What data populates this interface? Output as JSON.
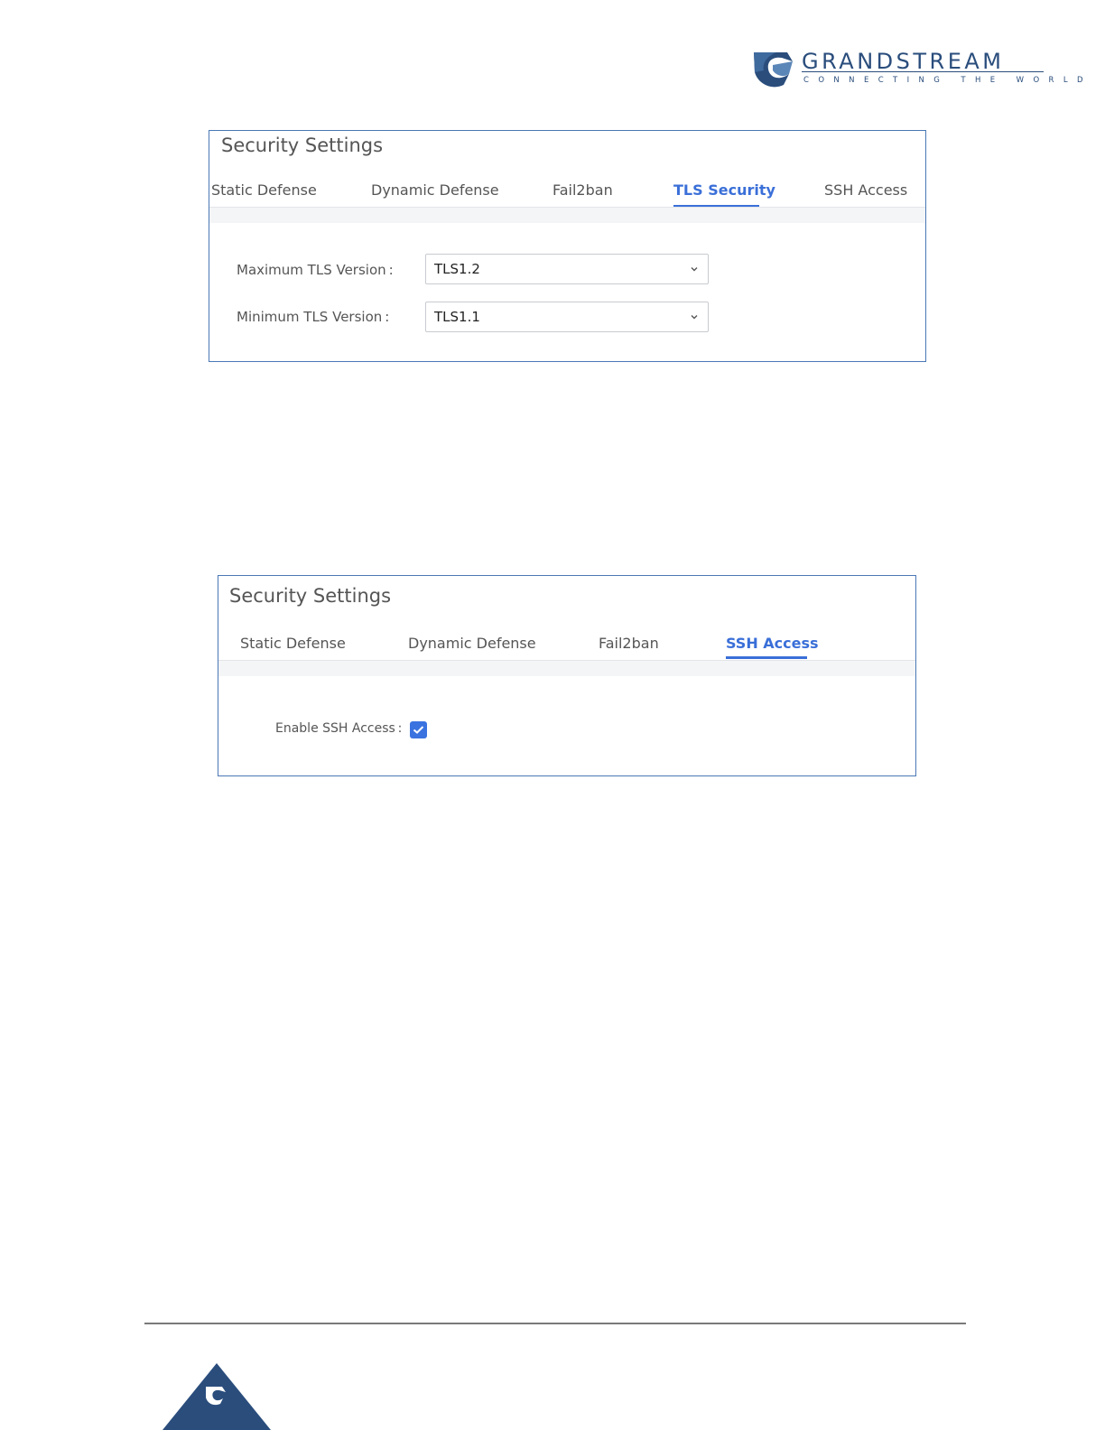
{
  "brand": {
    "name": "GRANDSTREAM",
    "tagline": "CONNECTING THE WORLD",
    "color": "#2a4d7c"
  },
  "panel_tls": {
    "title": "Security Settings",
    "tabs": [
      {
        "label": "Static Defense",
        "active": false
      },
      {
        "label": "Dynamic Defense",
        "active": false
      },
      {
        "label": "Fail2ban",
        "active": false
      },
      {
        "label": "TLS Security",
        "active": true
      },
      {
        "label": "SSH Access",
        "active": false
      }
    ],
    "fields": [
      {
        "label": "Maximum TLS Version :",
        "value": "TLS1.2"
      },
      {
        "label": "Minimum TLS Version :",
        "value": "TLS1.1"
      }
    ]
  },
  "panel_ssh": {
    "title": "Security Settings",
    "tabs": [
      {
        "label": "Static Defense",
        "active": false
      },
      {
        "label": "Dynamic Defense",
        "active": false
      },
      {
        "label": "Fail2ban",
        "active": false
      },
      {
        "label": "SSH Access",
        "active": true
      }
    ],
    "fields": [
      {
        "label": "Enable SSH Access :",
        "checked": true
      }
    ]
  },
  "colors": {
    "accent": "#3a6fd8",
    "panel_border": "#4a78b5"
  }
}
